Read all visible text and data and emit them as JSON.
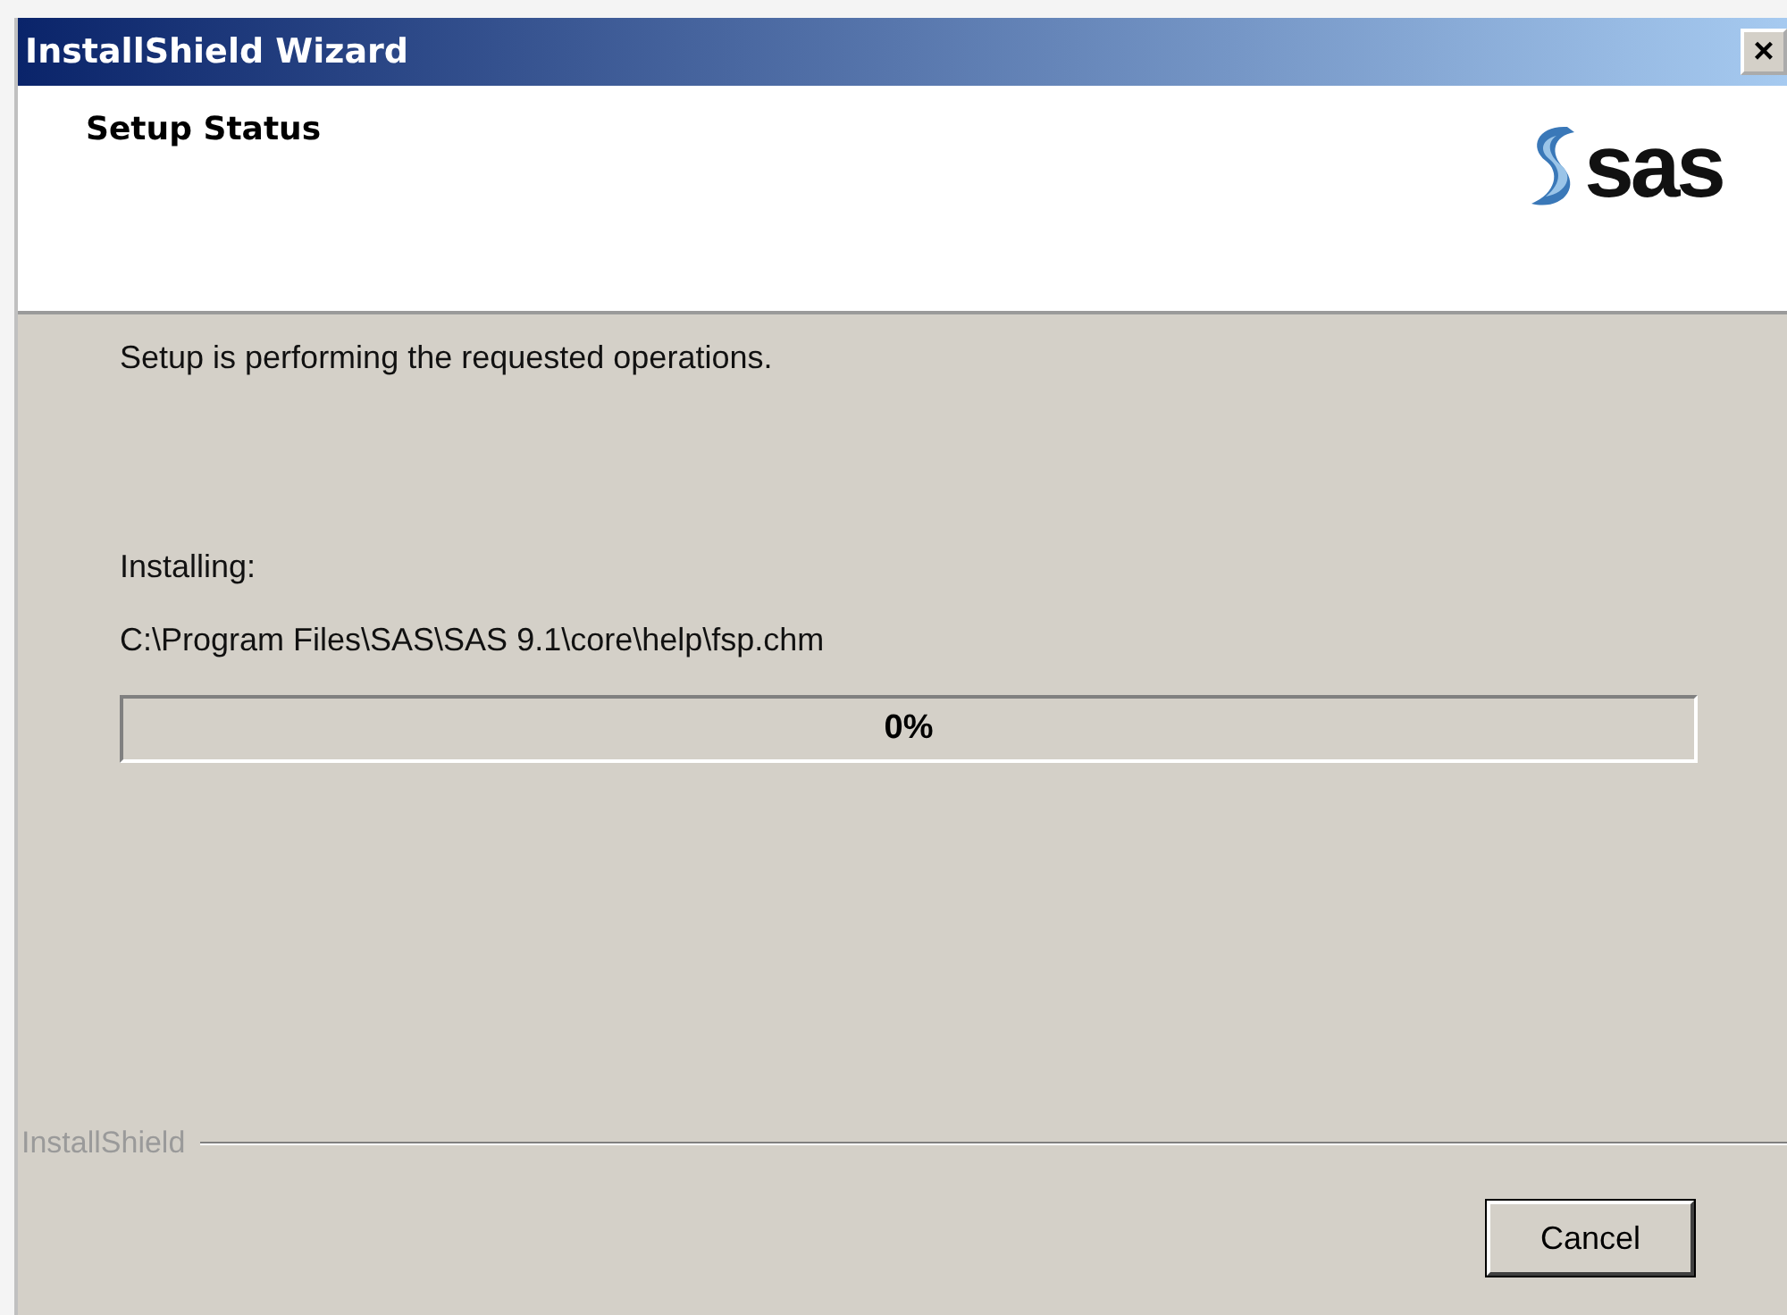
{
  "window": {
    "title": "InstallShield Wizard",
    "close": "×"
  },
  "header": {
    "title": "Setup Status",
    "logo_text": "sas"
  },
  "message": "Setup is performing the requested operations.",
  "status_label": "Installing:",
  "current_file": "C:\\Program Files\\SAS\\SAS 9.1\\core\\help\\fsp.chm",
  "progress": {
    "level": 0,
    "reading": "0%"
  },
  "brand": "InstallShield",
  "buttons": [
    {
      "label": "Cancel"
    }
  ]
}
